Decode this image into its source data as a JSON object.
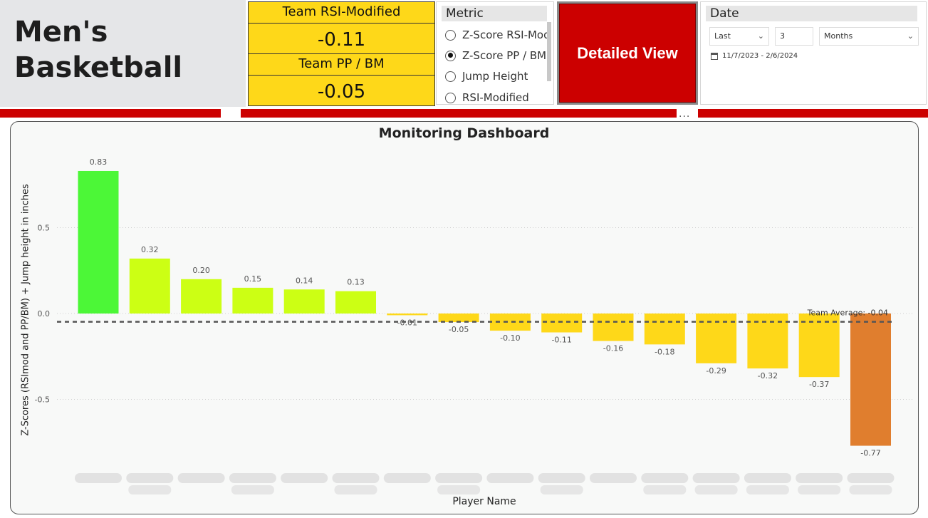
{
  "header": {
    "title_line1": "Men's",
    "title_line2": "Basketball"
  },
  "kpis": [
    {
      "label": "Team RSI-Modified",
      "value": "-0.11"
    },
    {
      "label": "Team PP / BM",
      "value": "-0.05"
    }
  ],
  "metric_slicer": {
    "title": "Metric",
    "options": [
      {
        "label": "Z-Score RSI-Mod",
        "selected": false
      },
      {
        "label": "Z-Score PP / BM",
        "selected": true
      },
      {
        "label": "Jump Height",
        "selected": false
      },
      {
        "label": "RSI-Modified",
        "selected": false
      }
    ]
  },
  "detail_button": {
    "label": "Detailed View"
  },
  "date_slicer": {
    "title": "Date",
    "relative": "Last",
    "count": "3",
    "unit": "Months",
    "range_text": "11/7/2023 - 2/6/2024"
  },
  "more_options": "...",
  "chart_data": {
    "type": "bar",
    "title": "Monitoring Dashboard",
    "xlabel": "Player Name",
    "ylabel": "Z-Scores (RSImod and PP/BM) + Jump height in inches",
    "ylim": [
      -0.85,
      0.9
    ],
    "yticks": [
      -0.5,
      0.0,
      0.5
    ],
    "ytick_labels": [
      "-0.5",
      "0.0",
      "0.5"
    ],
    "grid": true,
    "categories": [
      "",
      "",
      "",
      "",
      "",
      "",
      "",
      "",
      "",
      "",
      "",
      "",
      "",
      "",
      "",
      ""
    ],
    "values": [
      0.83,
      0.32,
      0.2,
      0.15,
      0.14,
      0.13,
      -0.01,
      -0.05,
      -0.1,
      -0.11,
      -0.16,
      -0.18,
      -0.29,
      -0.32,
      -0.37,
      -0.77
    ],
    "value_labels": [
      "0.83",
      "0.32",
      "0.20",
      "0.15",
      "0.14",
      "0.13",
      "-0.01",
      "-0.05",
      "-0.10",
      "-0.11",
      "-0.16",
      "-0.18",
      "-0.29",
      "-0.32",
      "-0.37",
      "-0.77"
    ],
    "bar_colors": [
      "#4cf737",
      "#ccff14",
      "#ccff14",
      "#ccff14",
      "#ccff14",
      "#ccff14",
      "#fed819",
      "#fed819",
      "#fed819",
      "#fed819",
      "#fed819",
      "#fed819",
      "#fed819",
      "#fed819",
      "#fed819",
      "#e07e2e"
    ],
    "reference_line": {
      "label": "Team Average: -0.04",
      "value": -0.04,
      "style": "dashed",
      "color": "#555555"
    }
  }
}
